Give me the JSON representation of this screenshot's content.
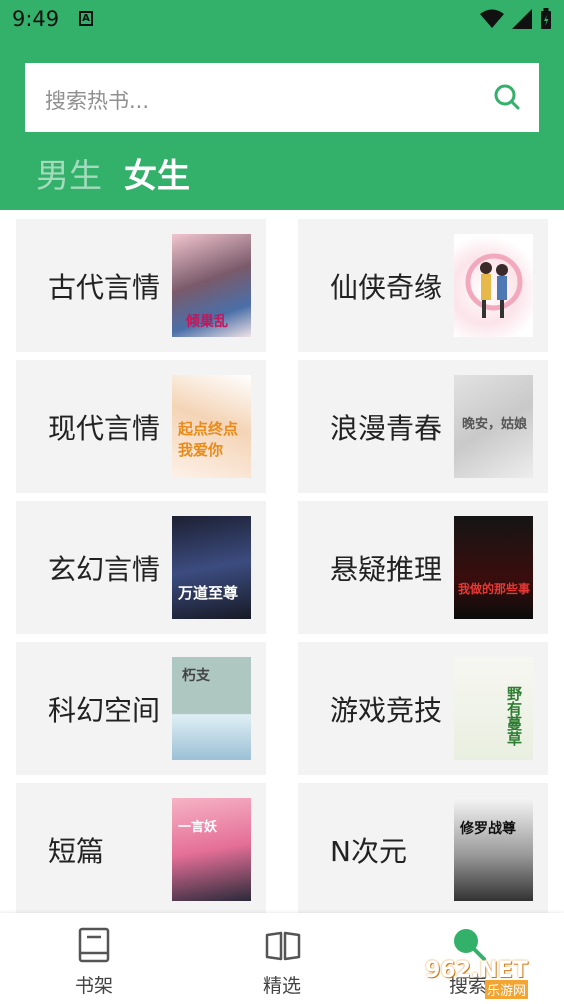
{
  "status_bar": {
    "time": "9:49",
    "notification_letter": "A"
  },
  "search": {
    "placeholder": "搜索热书..."
  },
  "tabs": [
    {
      "label": "男生",
      "active": false
    },
    {
      "label": "女生",
      "active": true
    }
  ],
  "categories": [
    {
      "label": "古代言情",
      "cover_text": "倾巢乱"
    },
    {
      "label": "仙侠奇缘",
      "cover_text": ""
    },
    {
      "label": "现代言情",
      "cover_text": "起点终点我爱你"
    },
    {
      "label": "浪漫青春",
      "cover_text": "晚安，姑娘"
    },
    {
      "label": "玄幻言情",
      "cover_text": "万道至尊"
    },
    {
      "label": "悬疑推理",
      "cover_text": "我做的那些事"
    },
    {
      "label": "科幻空间",
      "cover_text": "朽支"
    },
    {
      "label": "游戏竞技",
      "cover_text": "野有蔓草"
    },
    {
      "label": "短篇",
      "cover_text": "一言妖"
    },
    {
      "label": "N次元",
      "cover_text": "修罗战尊"
    }
  ],
  "bottom_nav": [
    {
      "label": "书架",
      "icon": "bookshelf-icon"
    },
    {
      "label": "精选",
      "icon": "open-book-icon"
    },
    {
      "label": "搜索",
      "icon": "search-icon"
    }
  ],
  "watermark": {
    "text": "962.NET",
    "sub": "乐游网"
  },
  "colors": {
    "brand_green": "#33b06a",
    "card_bg": "#f3f3f3"
  }
}
